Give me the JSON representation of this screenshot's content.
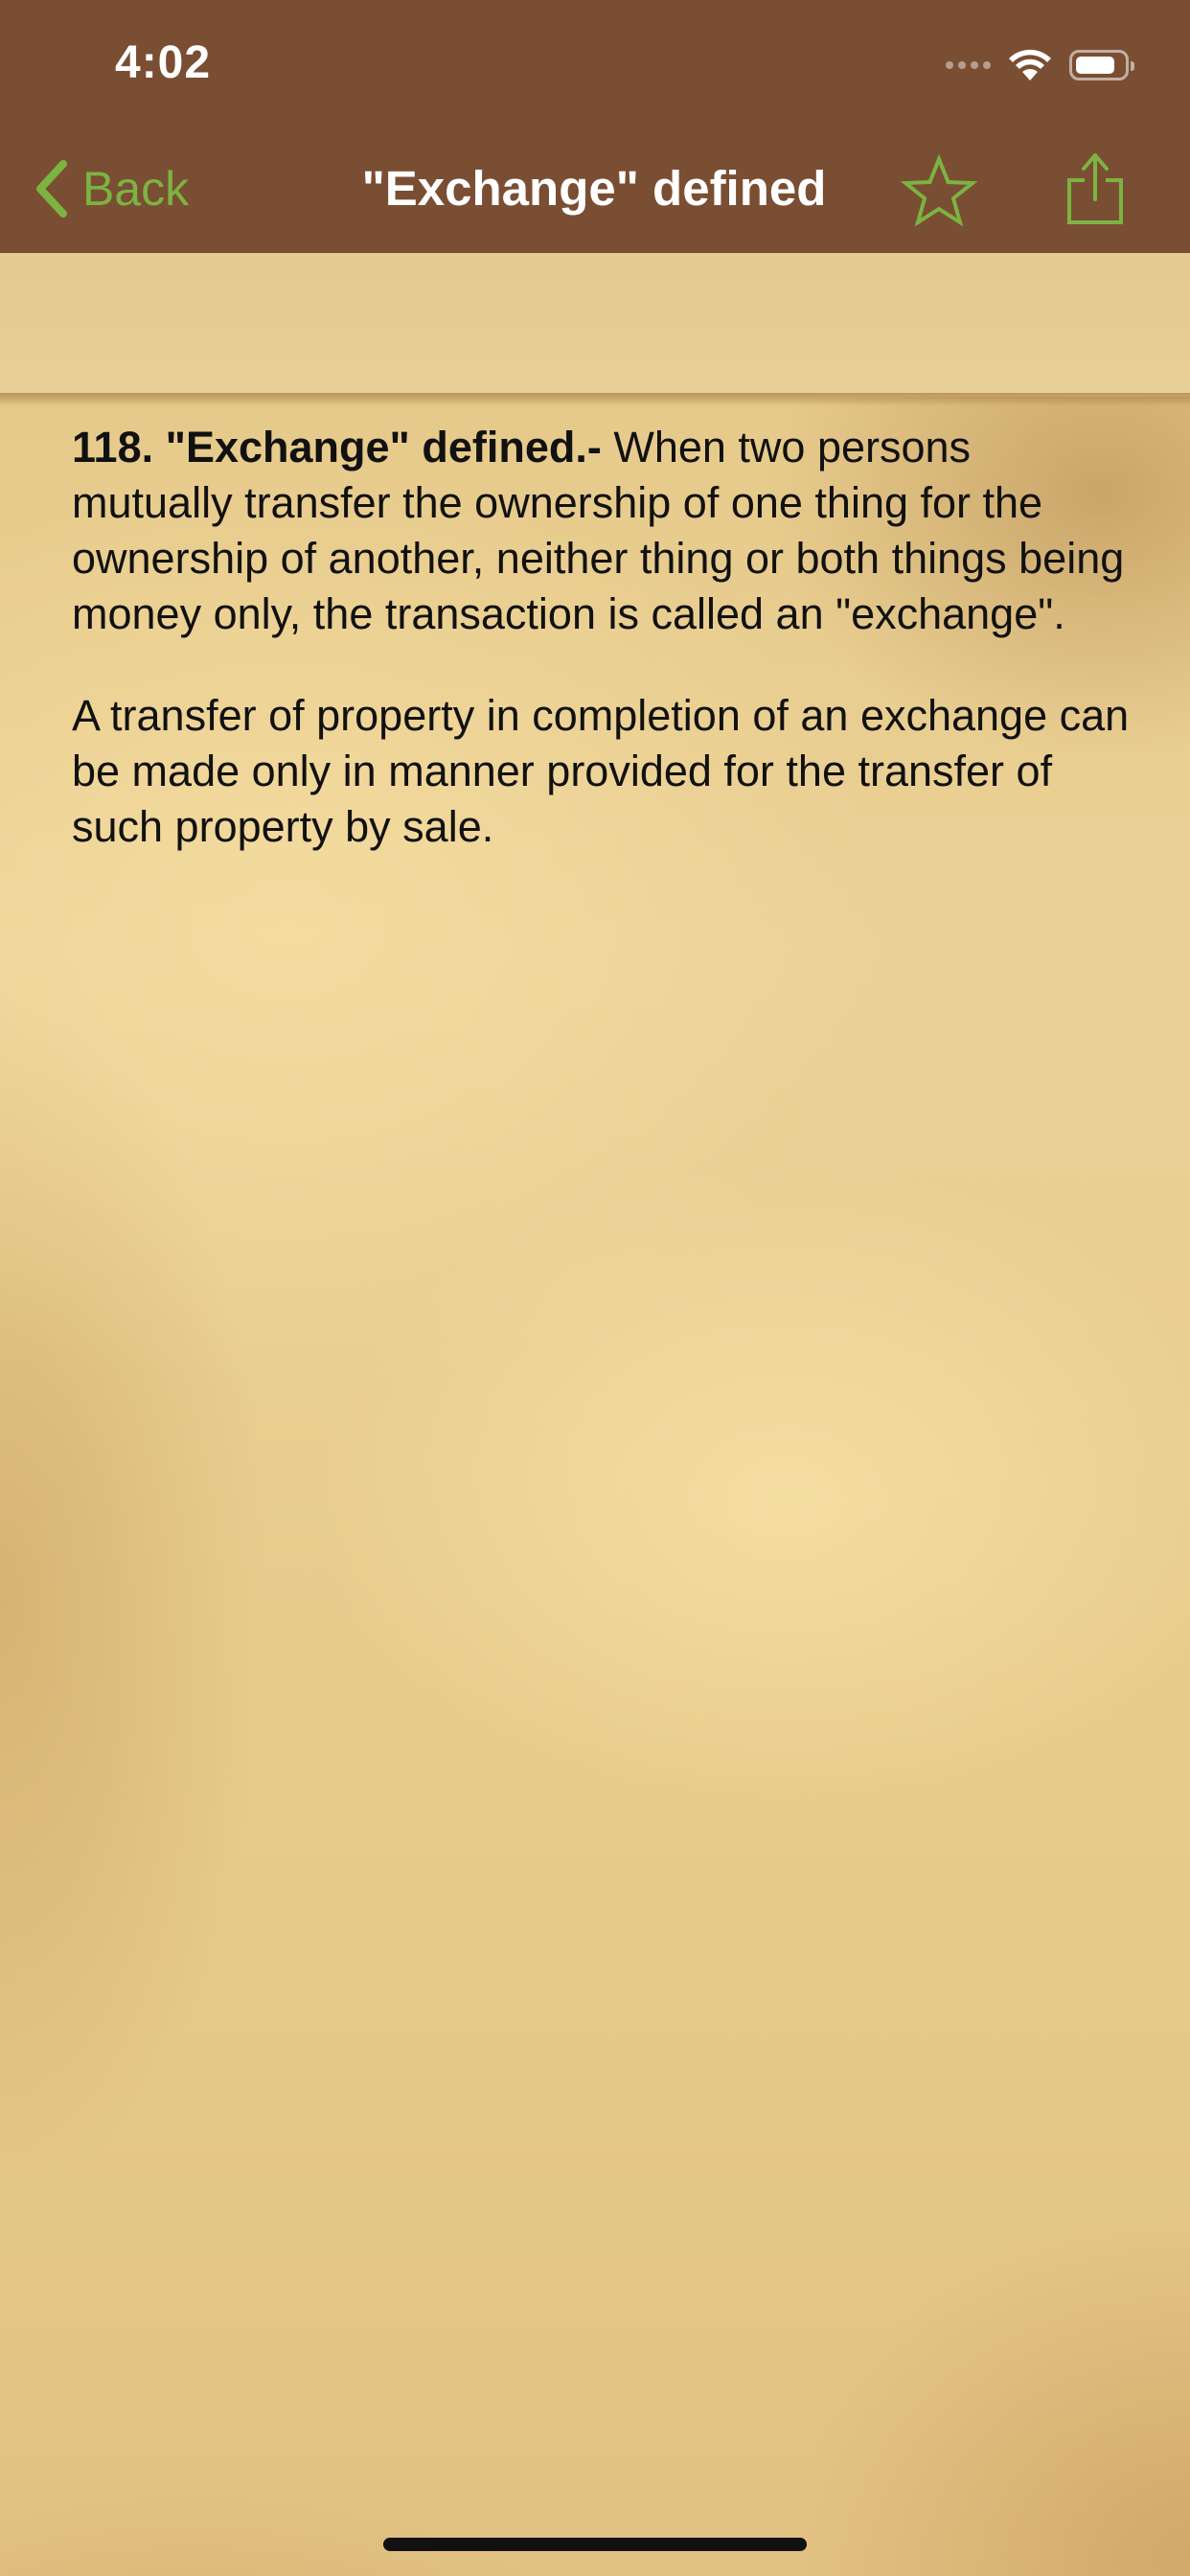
{
  "status_bar": {
    "time": "4:02"
  },
  "nav": {
    "back_label": "Back",
    "title": "\"Exchange\" defined",
    "icons": [
      "chevron-left-icon",
      "star-outline-icon",
      "share-icon"
    ],
    "accent_color": "#7cb342",
    "bar_color": "#7a4e33"
  },
  "section": {
    "heading": "118. \"Exchange\" defined.-",
    "paragraph_1": " When two persons mutually transfer the ownership of one thing for the ownership of another, neither thing or both things being money only, the transaction is called an \"exchange\".",
    "paragraph_2": "A transfer of property in completion of an exchange can be made only in manner provided for the transfer of such property by sale."
  }
}
